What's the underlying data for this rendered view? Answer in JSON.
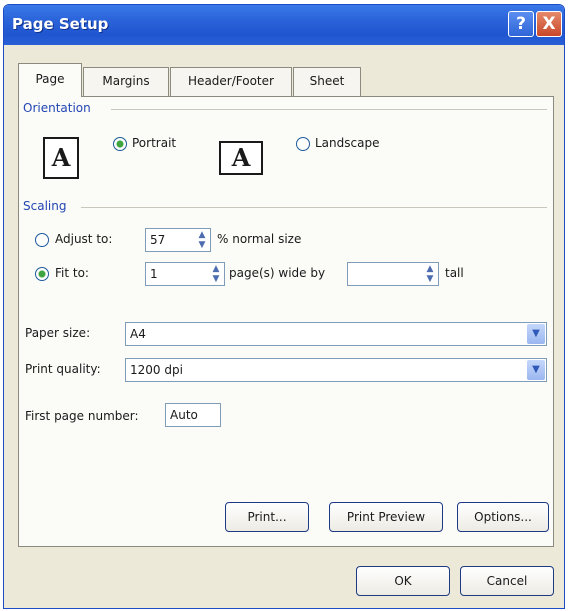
{
  "title": "Page Setup",
  "titlebar": {
    "help": "?",
    "close": "X"
  },
  "tabs": [
    "Page",
    "Margins",
    "Header/Footer",
    "Sheet"
  ],
  "orientation": {
    "label": "Orientation",
    "icon_letter": "A",
    "portrait": "Portrait",
    "landscape": "Landscape",
    "selected": "Portrait"
  },
  "scaling": {
    "label": "Scaling",
    "adjust_to_label": "Adjust to:",
    "adjust_to_value": "57",
    "normal_size": "% normal size",
    "fit_to_label": "Fit to:",
    "pages_wide": "1",
    "wide_by": "page(s) wide by",
    "pages_tall": "",
    "tall": "tall",
    "selected": "Fit to"
  },
  "paper_size": {
    "label": "Paper size:",
    "value": "A4"
  },
  "print_quality": {
    "label": "Print quality:",
    "value": "1200 dpi"
  },
  "first_page_number": {
    "label": "First page number:",
    "value": "Auto"
  },
  "buttons": {
    "print": "Print...",
    "print_preview": "Print Preview",
    "options": "Options...",
    "ok": "OK",
    "cancel": "Cancel"
  }
}
